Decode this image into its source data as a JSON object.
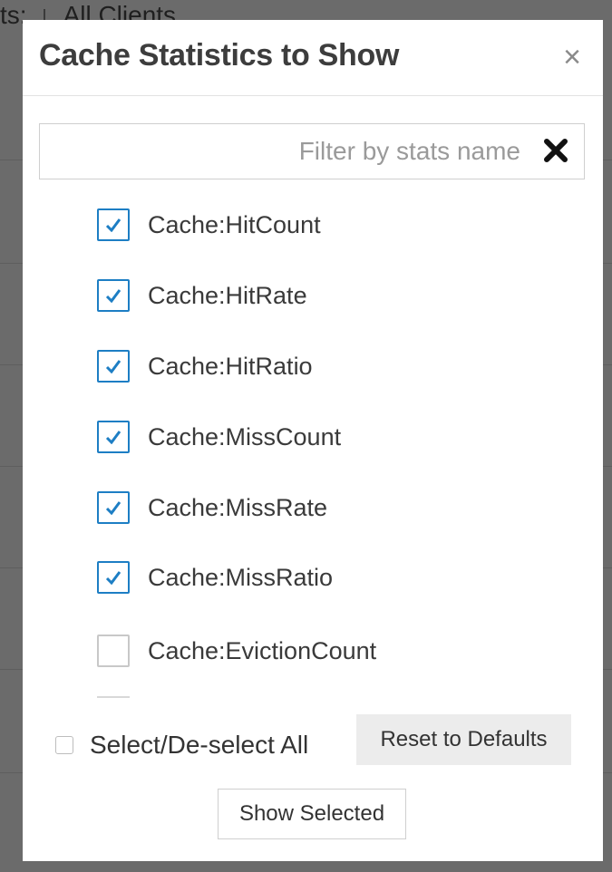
{
  "background": {
    "top_left_text": "ts:",
    "top_right_text": "All Clients"
  },
  "modal": {
    "title": "Cache Statistics to Show",
    "close_symbol": "×",
    "filter": {
      "placeholder": "Filter by stats name",
      "value": "",
      "clear_icon": "heavy-x-icon"
    },
    "stats": [
      {
        "label": "Cache:HitCount",
        "checked": true
      },
      {
        "label": "Cache:HitRate",
        "checked": true
      },
      {
        "label": "Cache:HitRatio",
        "checked": true
      },
      {
        "label": "Cache:MissCount",
        "checked": true
      },
      {
        "label": "Cache:MissRate",
        "checked": true
      },
      {
        "label": "Cache:MissRatio",
        "checked": true
      },
      {
        "label": "Cache:EvictionCount",
        "checked": false
      }
    ],
    "select_all_label": "Select/De-select All",
    "select_all_checked": false,
    "reset_label": "Reset to Defaults",
    "show_label": "Show Selected"
  },
  "colors": {
    "accent": "#1d7ec4",
    "overlay": "#6b6b6b"
  }
}
